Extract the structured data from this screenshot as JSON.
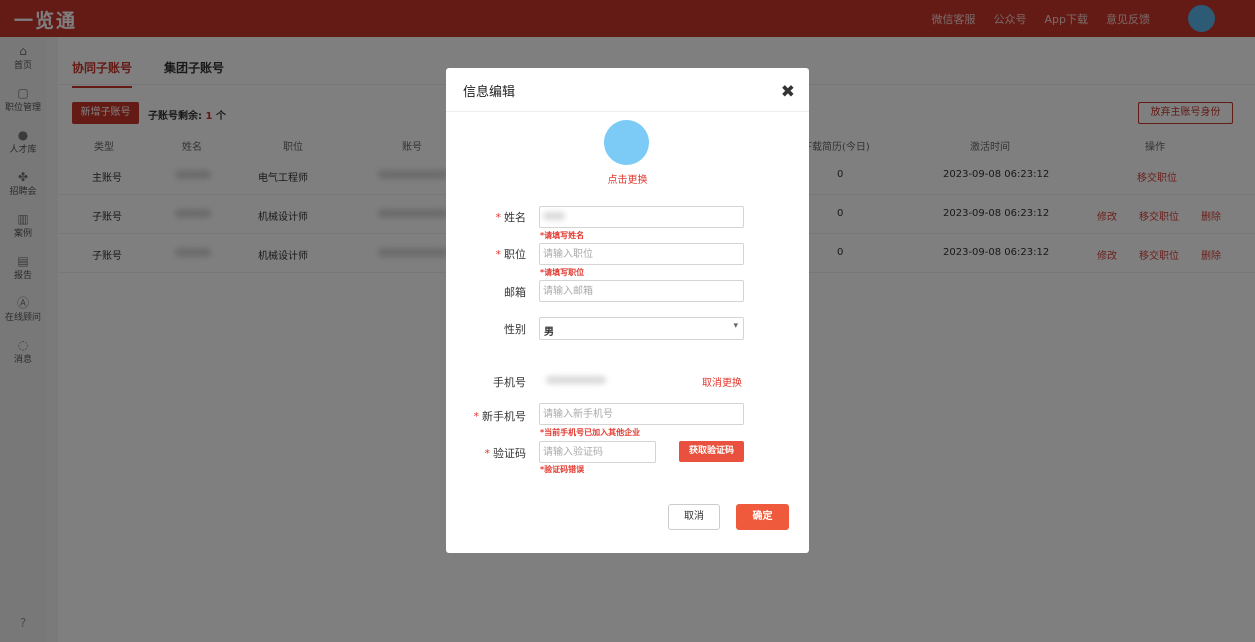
{
  "app": {
    "logo": "一览通"
  },
  "topnav": {
    "items": [
      "微信客服",
      "公众号",
      "App下载",
      "意见反馈"
    ]
  },
  "sidebar": {
    "items": [
      {
        "icon": "home-icon",
        "glyph": "⌂",
        "label": "首页"
      },
      {
        "icon": "briefcase-icon",
        "glyph": "▢",
        "label": "职位管理"
      },
      {
        "icon": "person-icon",
        "glyph": "●",
        "label": "人才库"
      },
      {
        "icon": "recruit-fair-icon",
        "glyph": "✤",
        "label": "招聘会"
      },
      {
        "icon": "book-icon",
        "glyph": "▥",
        "label": "案例"
      },
      {
        "icon": "report-icon",
        "glyph": "▤",
        "label": "报告"
      },
      {
        "icon": "consultant-icon",
        "glyph": "Ⓐ",
        "label": "在线顾问"
      },
      {
        "icon": "message-icon",
        "glyph": "◌",
        "label": "消息"
      }
    ],
    "help_glyph": "?"
  },
  "page": {
    "tabs": [
      "协同子账号",
      "集团子账号"
    ],
    "add_button": "新增子账号",
    "remain_label": "子账号剩余:",
    "remain_count": "1",
    "remain_unit": "个",
    "abandon_button": "放弃主账号身份"
  },
  "table": {
    "headers": [
      "类型",
      "姓名",
      "职位",
      "账号",
      "下载简历(今日)",
      "激活时间",
      "操作"
    ],
    "rows": [
      {
        "type": "主账号",
        "position": "电气工程师",
        "downloads": "0",
        "activated": "2023-09-08 06:23:12",
        "actions": [
          "移交职位"
        ]
      },
      {
        "type": "子账号",
        "position": "机械设计师",
        "downloads": "0",
        "activated": "2023-09-08 06:23:12",
        "actions": [
          "修改",
          "移交职位",
          "删除"
        ]
      },
      {
        "type": "子账号",
        "position": "机械设计师",
        "downloads": "0",
        "activated": "2023-09-08 06:23:12",
        "actions": [
          "修改",
          "移交职位",
          "删除"
        ]
      }
    ]
  },
  "modal": {
    "title": "信息编辑",
    "close": "✖",
    "change_avatar": "点击更换",
    "name": {
      "label": "姓名",
      "value": "",
      "error": "*请填写姓名"
    },
    "position": {
      "label": "职位",
      "placeholder": "请输入职位",
      "error": "*请填写职位"
    },
    "email": {
      "label": "邮箱",
      "placeholder": "请输入邮箱"
    },
    "gender": {
      "label": "性别",
      "value": "男"
    },
    "phone": {
      "label": "手机号",
      "cancel_change": "取消更换"
    },
    "new_phone": {
      "label": "新手机号",
      "placeholder": "请输入新手机号",
      "error": "*当前手机号已加入其他企业"
    },
    "code": {
      "label": "验证码",
      "placeholder": "请输入验证码",
      "error": "*验证码错误",
      "get_code": "获取验证码"
    },
    "cancel": "取消",
    "confirm": "确定"
  }
}
